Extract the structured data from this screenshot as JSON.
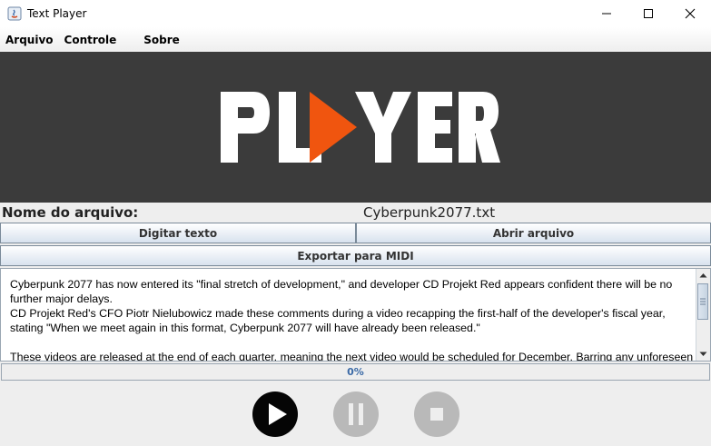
{
  "window": {
    "title": "Text Player"
  },
  "menu": {
    "items": [
      "Arquivo",
      "Controle",
      "Sobre"
    ]
  },
  "banner": {
    "logo_text": "PLAYER",
    "logo_accent_color": "#f0550f"
  },
  "file": {
    "label": "Nome do arquivo:",
    "value": "Cyberpunk2077.txt"
  },
  "buttons": {
    "digitar": "Digitar texto",
    "abrir": "Abrir arquivo",
    "exportar": "Exportar para MIDI"
  },
  "text_area": {
    "lines": [
      "Cyberpunk 2077 has now entered its \"final stretch of development,\" and developer CD Projekt Red appears confident there will be no further major delays.",
      "CD Projekt Red's CFO Piotr Nielubowicz made these comments during a video recapping the first-half of the developer's fiscal year, stating \"When we meet again in this format, Cyberpunk 2077 will have already been released.\"",
      "",
      "These videos are released at the end of each quarter, meaning the next video would be scheduled for December. Barring any unforeseen"
    ]
  },
  "progress": {
    "label": "0%",
    "value": 0
  },
  "controls": {
    "play": "play-icon",
    "pause": "pause-icon",
    "stop": "stop-icon"
  },
  "colors": {
    "banner_bg": "#3b3b3b",
    "play_bg": "#050505",
    "disabled_bg": "#b9b9b9",
    "progress_text": "#3b6aa6"
  }
}
